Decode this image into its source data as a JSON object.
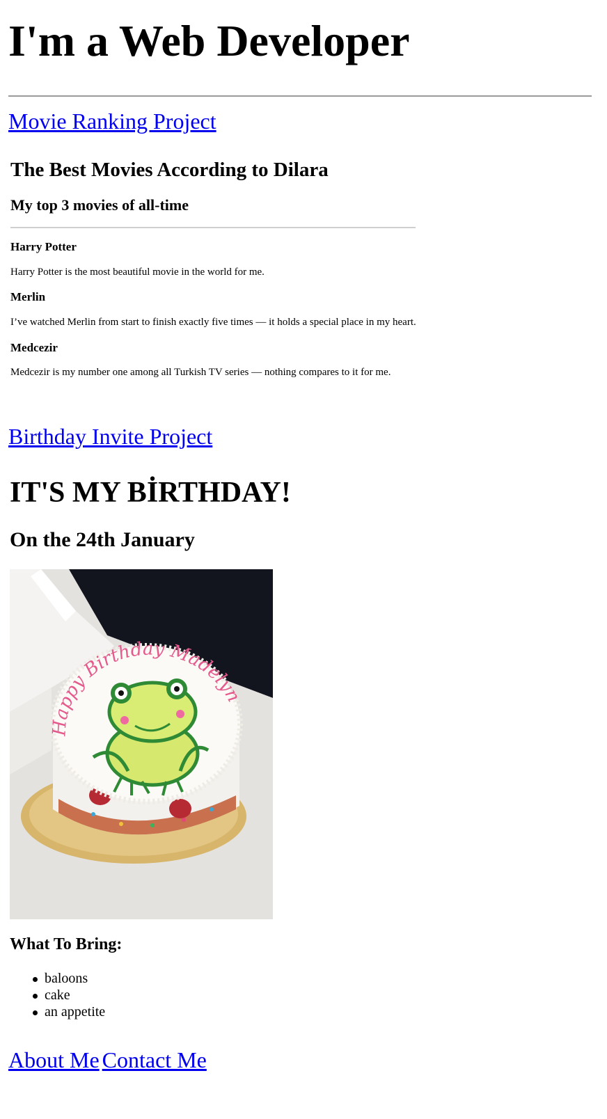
{
  "header": {
    "title": "I'm a Web Developer"
  },
  "links": {
    "movie_project": "Movie Ranking Project",
    "birthday_project": "Birthday Invite Project",
    "about_me": "About Me",
    "contact_me": "Contact Me"
  },
  "movies": {
    "title": "The Best Movies According to Dilara",
    "subtitle": "My top 3 movies of all-time",
    "items": [
      {
        "title": "Harry Potter",
        "desc": "Harry Potter is the most beautiful movie in the world for me."
      },
      {
        "title": "Merlin",
        "desc": "I’ve watched Merlin from start to finish exactly five times — it holds a special place in my heart."
      },
      {
        "title": "Medcezir",
        "desc": "Medcezir is my number one among all Turkish TV series — nothing compares to it for me."
      }
    ]
  },
  "birthday": {
    "title": "IT'S MY BİRTHDAY!",
    "date": "On the 24th January",
    "image_alt": "frog-birthday-cake-photo",
    "cake_text": "Happy Birthday Madelyn",
    "bring_heading": "What To Bring:",
    "bring_items": [
      "baloons",
      "cake",
      "an appetite"
    ]
  },
  "colors": {
    "link": "#0000ee",
    "rule": "#9a9a9a"
  }
}
